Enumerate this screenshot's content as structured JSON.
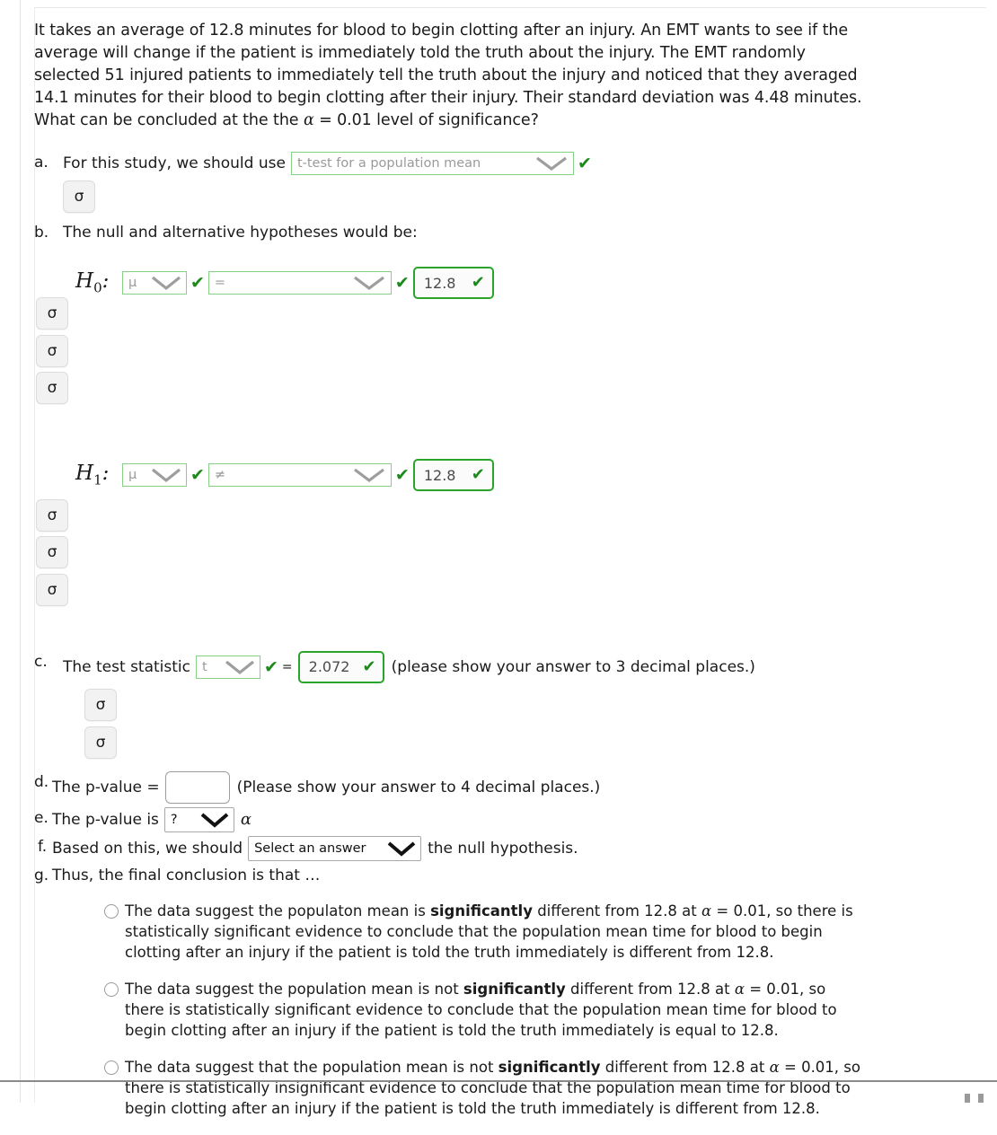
{
  "problem": {
    "text_line1": "It takes an average of 12.8 minutes for blood to begin clotting after an injury.  An EMT wants to see if the",
    "text_line2": "average will change if the patient is immediately told the truth about the injury. The EMT randomly",
    "text_line3": "selected 51 injured patients to immediately tell the truth about the injury and noticed that they averaged",
    "text_line4": "14.1 minutes for their blood to begin clotting after their injury. Their standard deviation was 4.48 minutes.",
    "text_line5_a": "What can be concluded at the the ",
    "text_line5_alpha": "α",
    "text_line5_b": " = 0.01 level of significance?"
  },
  "sigma_button_label": "σ",
  "check_glyph": "✔",
  "parts": {
    "a": {
      "letter": "a.",
      "prompt": "For this study, we should use",
      "select_value": "t-test for a population mean",
      "validated": true
    },
    "b": {
      "letter": "b.",
      "prompt": "The null and alternative hypotheses would be:",
      "h0": {
        "label": "H",
        "sub": "0",
        "colon": ":",
        "param_select": "μ",
        "relation_select": "=",
        "value": "12.8"
      },
      "h1": {
        "label": "H",
        "sub": "1",
        "colon": ":",
        "param_select": "μ",
        "relation_select": "≠",
        "value": "12.8"
      }
    },
    "c": {
      "letter": "c.",
      "prompt": "The test statistic",
      "stat_select": "t",
      "equals": "=",
      "value": "2.072",
      "note": "(please show your answer to 3 decimal places.)"
    },
    "d": {
      "letter": "d.",
      "prompt": "The p-value =",
      "value": "",
      "note": "(Please show your answer to 4 decimal places.)"
    },
    "e": {
      "letter": "e.",
      "prompt": "The p-value is",
      "select_value": "?",
      "suffix_alpha": "α"
    },
    "f": {
      "letter": "f.",
      "prompt": "Based on this, we should",
      "select_value": "Select an answer",
      "suffix": "the null hypothesis."
    },
    "g": {
      "letter": "g.",
      "prompt": "Thus, the final conclusion is that …"
    }
  },
  "conclusion_options": [
    {
      "seg1": "The data suggest the populaton mean is ",
      "bold": "significantly",
      "seg2": " different from 12.8 at ",
      "alpha": "α",
      "seg3": " = 0.01, so there is statistically significant evidence to conclude that the population mean time for blood to begin clotting after an injury if the patient is told the truth immediately is different from 12.8.",
      "selected": false
    },
    {
      "seg1": "The data suggest the population mean is not ",
      "bold": "significantly",
      "seg2": " different from 12.8 at ",
      "alpha": "α",
      "seg3": " = 0.01, so there is statistically significant evidence to conclude that the population mean time for blood to begin clotting after an injury if the patient is told the truth immediately is equal to 12.8.",
      "selected": false
    },
    {
      "seg1": "The data suggest that the population mean is not ",
      "bold": "significantly",
      "seg2": " different from 12.8 at ",
      "alpha": "α",
      "seg3": " = 0.01, so there is statistically insignificant evidence to conclude that the population mean time for blood to begin clotting after an injury if the patient is told the truth immediately is different from 12.8.",
      "selected": false
    }
  ],
  "colors": {
    "valid_border": "#2aa52a",
    "soft_green_border": "#86d186",
    "check_green": "#1b8a1b",
    "placeholder_grey": "#9a9a9a",
    "neutral_border": "#a8a8a8"
  }
}
